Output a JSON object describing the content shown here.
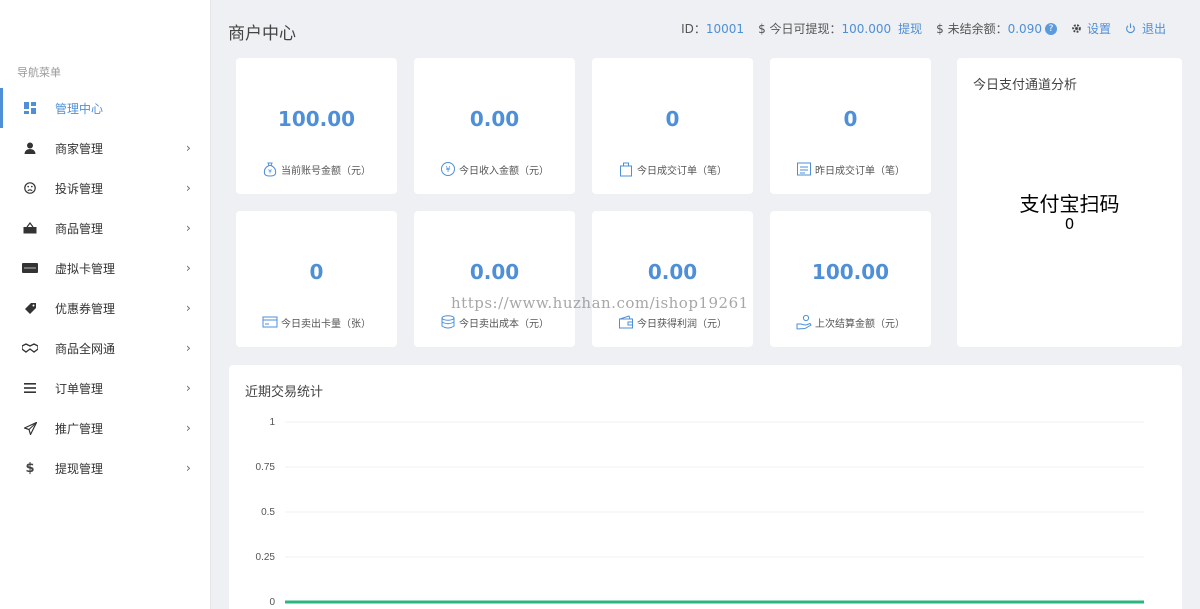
{
  "sidebar": {
    "caption": "导航菜单",
    "items": [
      {
        "label": "管理中心",
        "icon": "dashboard-icon",
        "active": true
      },
      {
        "label": "商家管理",
        "icon": "user-icon"
      },
      {
        "label": "投诉管理",
        "icon": "frown-icon"
      },
      {
        "label": "商品管理",
        "icon": "basket-icon"
      },
      {
        "label": "虚拟卡管理",
        "icon": "card-icon"
      },
      {
        "label": "优惠券管理",
        "icon": "tag-icon"
      },
      {
        "label": "商品全网通",
        "icon": "handshake-icon"
      },
      {
        "label": "订单管理",
        "icon": "list-icon"
      },
      {
        "label": "推广管理",
        "icon": "paper-plane-icon"
      },
      {
        "label": "提现管理",
        "icon": "dollar-icon"
      }
    ]
  },
  "header": {
    "title": "商户中心",
    "id_label": "ID：",
    "id_value": "10001",
    "withdrawable_label": "$ 今日可提现：",
    "withdrawable_value": "100.000",
    "withdraw_link": "提现",
    "unsettled_label": "$ 未结余额：",
    "unsettled_value": "0.090",
    "help_mark": "?",
    "settings_label": "设置",
    "logout_label": "退出"
  },
  "cards": [
    {
      "value": "100.00",
      "label": "当前账号金额（元）",
      "icon": "money-bag-icon"
    },
    {
      "value": "0.00",
      "label": "今日收入金额（元）",
      "icon": "yen-coin-icon"
    },
    {
      "value": "0",
      "label": "今日成交订单（笔）",
      "icon": "shopping-bag-icon"
    },
    {
      "value": "0",
      "label": "昨日成交订单（笔）",
      "icon": "receipt-icon"
    },
    {
      "value": "0",
      "label": "今日卖出卡量（张）",
      "icon": "card-icon"
    },
    {
      "value": "0.00",
      "label": "今日卖出成本（元）",
      "icon": "coins-stack-icon"
    },
    {
      "value": "0.00",
      "label": "今日获得利润（元）",
      "icon": "wallet-icon"
    },
    {
      "value": "100.00",
      "label": "上次结算金额（元）",
      "icon": "hand-coins-icon"
    }
  ],
  "pay_panel": {
    "title": "今日支付通道分析",
    "method": "支付宝扫码",
    "count": "0"
  },
  "stats": {
    "title": "近期交易统计"
  },
  "chart_data": {
    "type": "line",
    "title": "近期交易统计",
    "yticks": [
      "1",
      "0.75",
      "0.5",
      "0.25",
      "0"
    ],
    "ylim": [
      0,
      1
    ],
    "series": [
      {
        "values": [
          0,
          0
        ]
      }
    ],
    "series_color": "#2bb67d",
    "grid": true
  },
  "watermark": "https://www.huzhan.com/ishop19261",
  "colors": {
    "accent": "#4e8fd8",
    "line": "#2bb67d"
  }
}
